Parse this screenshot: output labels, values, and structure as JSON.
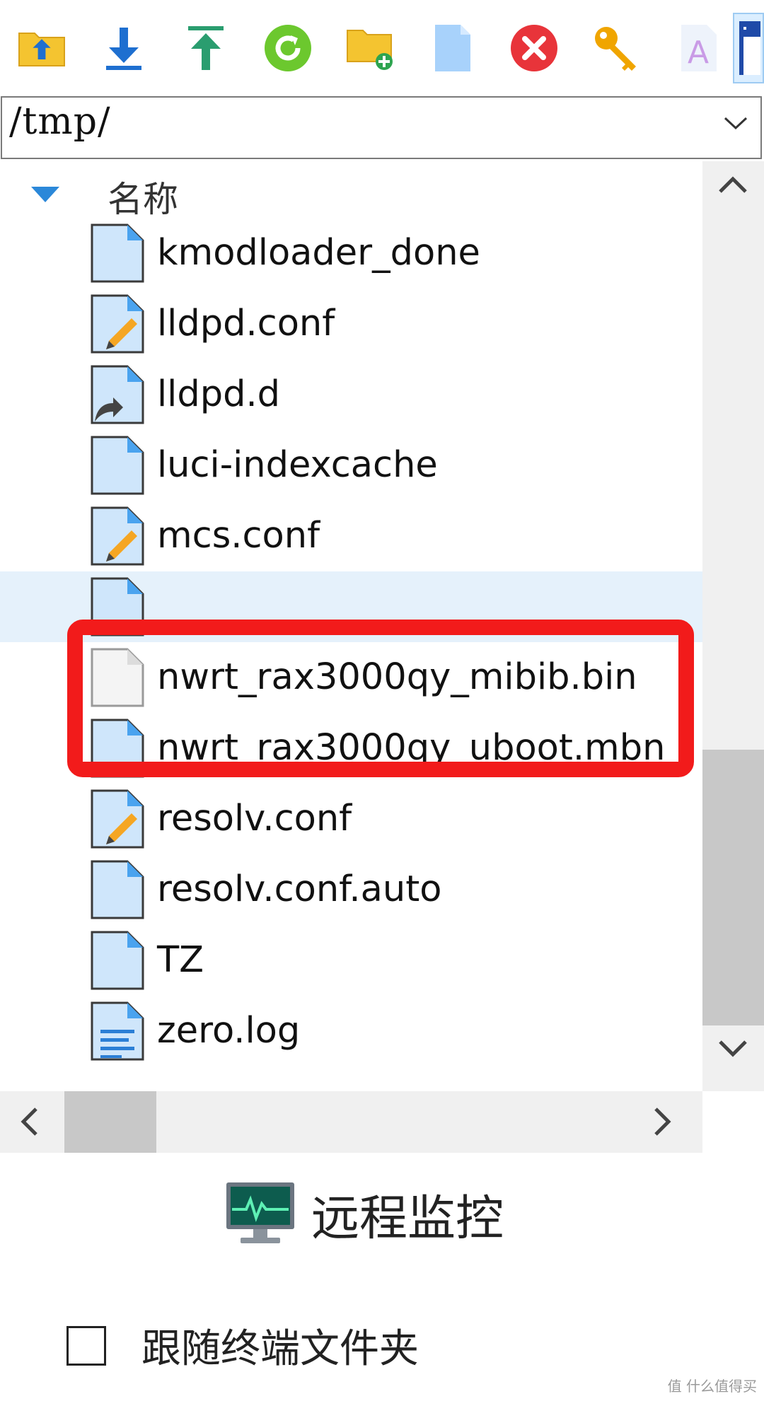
{
  "toolbar": {
    "buttons": [
      {
        "name": "parent-folder-button",
        "icon": "folder-up-icon"
      },
      {
        "name": "download-button",
        "icon": "download-icon"
      },
      {
        "name": "upload-button",
        "icon": "upload-icon"
      },
      {
        "name": "refresh-button",
        "icon": "refresh-icon"
      },
      {
        "name": "new-folder-button",
        "icon": "new-folder-icon"
      },
      {
        "name": "new-file-button",
        "icon": "new-file-icon"
      },
      {
        "name": "delete-button",
        "icon": "delete-icon"
      },
      {
        "name": "permissions-button",
        "icon": "key-icon"
      },
      {
        "name": "rename-button",
        "icon": "rename-icon"
      },
      {
        "name": "terminal-view-button",
        "icon": "window-icon"
      }
    ]
  },
  "path": {
    "value": "/tmp/"
  },
  "list": {
    "column_name": "名称",
    "files": [
      {
        "name": "kmodloader_done",
        "icon": "file-icon"
      },
      {
        "name": "lldpd.conf",
        "icon": "file-edit-icon"
      },
      {
        "name": "lldpd.d",
        "icon": "file-link-icon"
      },
      {
        "name": "luci-indexcache",
        "icon": "file-icon"
      },
      {
        "name": "mcs.conf",
        "icon": "file-edit-icon"
      },
      {
        "name": "",
        "icon": "file-icon"
      },
      {
        "name": "nwrt_rax3000qy_mibib.bin",
        "icon": "file-blank-icon"
      },
      {
        "name": "nwrt_rax3000qy_uboot.mbn",
        "icon": "file-icon"
      },
      {
        "name": "resolv.conf",
        "icon": "file-edit-icon"
      },
      {
        "name": "resolv.conf.auto",
        "icon": "file-icon"
      },
      {
        "name": "TZ",
        "icon": "file-icon"
      },
      {
        "name": "zero.log",
        "icon": "file-text-icon"
      }
    ]
  },
  "monitor": {
    "label": "远程监控"
  },
  "follow": {
    "label": "跟随终端文件夹",
    "checked": false
  },
  "watermark": "值 什么值得买",
  "colors": {
    "highlight": "#f21b1b",
    "file_icon": "#cfe6fb",
    "hover_row": "#e5f1fb"
  }
}
